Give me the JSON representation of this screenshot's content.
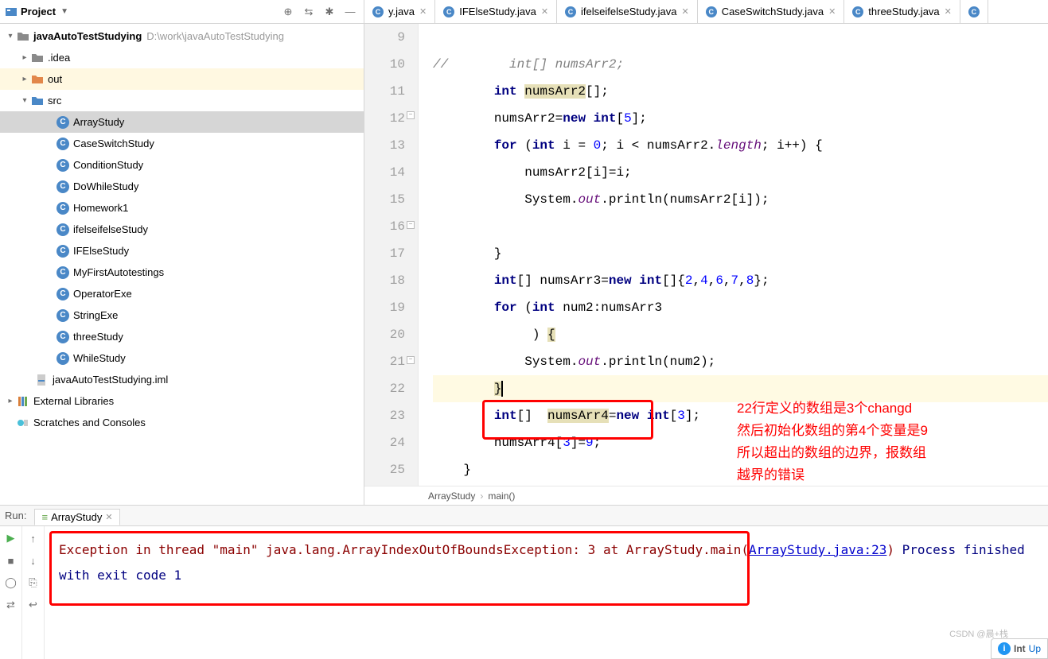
{
  "project_panel": {
    "title": "Project",
    "root": {
      "name": "javaAutoTestStudying",
      "path": "D:\\work\\javaAutoTestStudying"
    },
    "folders": {
      "idea": ".idea",
      "out": "out",
      "src": "src"
    },
    "classes": [
      "ArrayStudy",
      "CaseSwitchStudy",
      "ConditionStudy",
      "DoWhileStudy",
      "Homework1",
      "ifelseifelseStudy",
      "IFElseStudy",
      "MyFirstAutotestings",
      "OperatorExe",
      "StringExe",
      "threeStudy",
      "WhileStudy"
    ],
    "iml": "javaAutoTestStudying.iml",
    "ext_lib": "External Libraries",
    "scratches": "Scratches and Consoles"
  },
  "tabs": [
    "y.java",
    "IFElseStudy.java",
    "ifelseifelseStudy.java",
    "CaseSwitchStudy.java",
    "threeStudy.java"
  ],
  "gutter_lines": [
    "9",
    "10",
    "11",
    "12",
    "13",
    "14",
    "15",
    "16",
    "17",
    "18",
    "19",
    "20",
    "21",
    "22",
    "23",
    "24",
    "25"
  ],
  "code": {
    "l9": "//        int[] numsArr2;",
    "l10a": "int ",
    "l10b": "numsArr2",
    "l10c": "[];",
    "l11a": "numsArr2=",
    "l11b": "new int",
    "l11c": "[",
    "l11d": "5",
    "l11e": "];",
    "l12a": "for ",
    "l12b": "(",
    "l12c": "int ",
    "l12d": "i = ",
    "l12e": "0",
    "l12f": "; i < numsArr2.",
    "l12g": "length",
    "l12h": "; i++) {",
    "l13": "numsArr2[i]=i;",
    "l14a": "System.",
    "l14b": "out",
    "l14c": ".println(numsArr2[i]);",
    "l16": "}",
    "l17a": "int",
    "l17b": "[] numsArr3=",
    "l17c": "new int",
    "l17d": "[]{",
    "l17e": "2",
    "l17f": "4",
    "l17g": "6",
    "l17h": "7",
    "l17i": "8",
    "l17j": "};",
    "l18a": "for ",
    "l18b": "(",
    "l18c": "int ",
    "l18d": "num2:numsArr3",
    "l19a": ") ",
    "l19b": "{",
    "l20a": "System.",
    "l20b": "out",
    "l20c": ".println(num2);",
    "l21": "}",
    "l22a": "int",
    "l22b": "[]  ",
    "l22c": "numsArr4",
    "l22d": "=",
    "l22e": "new int",
    "l22f": "[",
    "l22g": "3",
    "l22h": "];",
    "l23a": "numsArr4[",
    "l23b": "3",
    "l23c": "]=",
    "l23d": "9",
    "l23e": ";",
    "l24": "}",
    "l25": "}"
  },
  "annotation": "22行定义的数组是3个changd\n然后初始化数组的第4个变量是9\n所以超出的数组的边界，报数组\n越界的错误",
  "breadcrumb": {
    "a": "ArrayStudy",
    "b": "main()"
  },
  "run": {
    "label": "Run:",
    "file": "ArrayStudy",
    "exc1": "Exception in thread \"main\" java.lang.ArrayIndexOutOfBoundsException: 3",
    "exc2a": "\tat ArrayStudy.main(",
    "exc2b": "ArrayStudy.java:23",
    "exc2c": ")",
    "exit": "Process finished with exit code 1"
  },
  "hints": {
    "info": "Int",
    "upd": "Up",
    "watermark": "CSDN @晨+栈"
  }
}
